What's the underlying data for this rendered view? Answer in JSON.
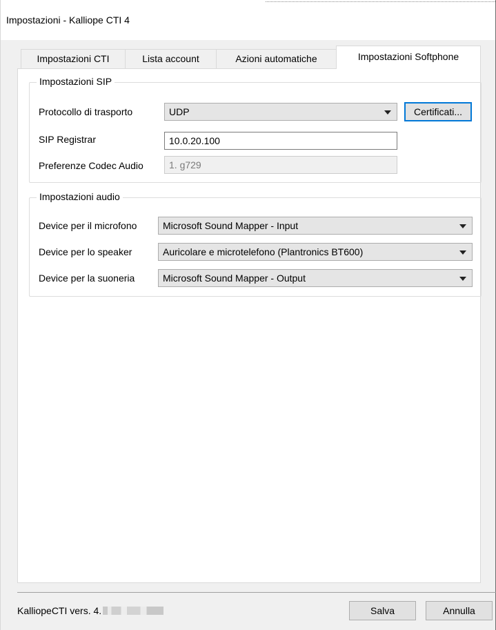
{
  "window": {
    "title": "Impostazioni - Kalliope CTI 4"
  },
  "tabs": [
    {
      "label": "Impostazioni CTI",
      "active": false
    },
    {
      "label": "Lista account",
      "active": false
    },
    {
      "label": "Azioni automatiche",
      "active": false
    },
    {
      "label": "Impostazioni Softphone",
      "active": true
    }
  ],
  "sip": {
    "legend": "Impostazioni SIP",
    "transport_label": "Protocollo di trasporto",
    "transport_value": "UDP",
    "certificates_button": "Certificati...",
    "registrar_label": "SIP Registrar",
    "registrar_value": "10.0.20.100",
    "codec_label": "Preferenze Codec Audio",
    "codec_value": "1. g729"
  },
  "audio": {
    "legend": "Impostazioni audio",
    "mic_label": "Device per il microfono",
    "mic_value": "Microsoft Sound Mapper - Input",
    "speaker_label": "Device per lo speaker",
    "speaker_value": "Auricolare e microtelefono (Plantronics BT600)",
    "ringer_label": "Device per la suoneria",
    "ringer_value": "Microsoft Sound Mapper - Output"
  },
  "footer": {
    "version_prefix": "KalliopeCTI vers. 4.",
    "save_button": "Salva",
    "cancel_button": "Annulla"
  },
  "colors": {
    "focus_accent": "#0078d7",
    "tab_panel_bg": "#ffffff",
    "window_bg": "#f0f0f0"
  }
}
